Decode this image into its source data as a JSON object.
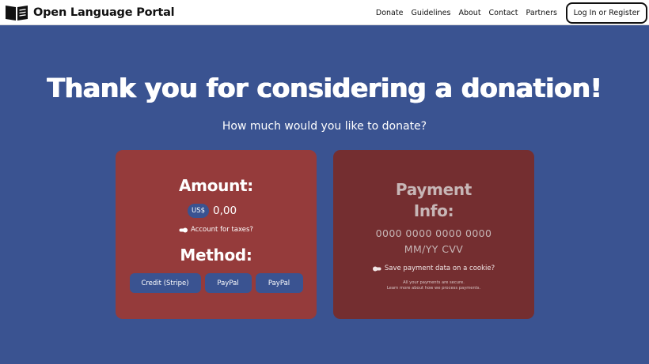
{
  "header": {
    "brand": "Open Language Portal",
    "nav": [
      "Donate",
      "Guidelines",
      "About",
      "Contact",
      "Partners"
    ],
    "login_label": "Log In or Register"
  },
  "hero": {
    "title": "Thank you for considering a donation!",
    "subtitle": "How much would you like to donate?"
  },
  "amount_card": {
    "heading": "Amount:",
    "currency": "US$",
    "amount_value": "0,00",
    "tax_toggle_label": "Account for taxes?",
    "tax_toggle_on": true,
    "method_heading": "Method:",
    "methods": [
      "Credit (Stripe)",
      "PayPal",
      "PayPal"
    ]
  },
  "payment_card": {
    "heading_line1": "Payment",
    "heading_line2": "Info:",
    "card_number_placeholder": "0000 0000 0000 0000",
    "expiry_cvv_placeholder": "MM/YY CVV",
    "save_toggle_label": "Save payment data on a cookie?",
    "save_toggle_on": false,
    "secure_note": "All your payments are secure.",
    "learn_more": "Learn more about how we process payments."
  },
  "colors": {
    "page_bg": "#3a5391",
    "amount_card_bg": "#953b3b",
    "payment_card_bg": "#742e30",
    "button_bg": "#3a5391"
  }
}
